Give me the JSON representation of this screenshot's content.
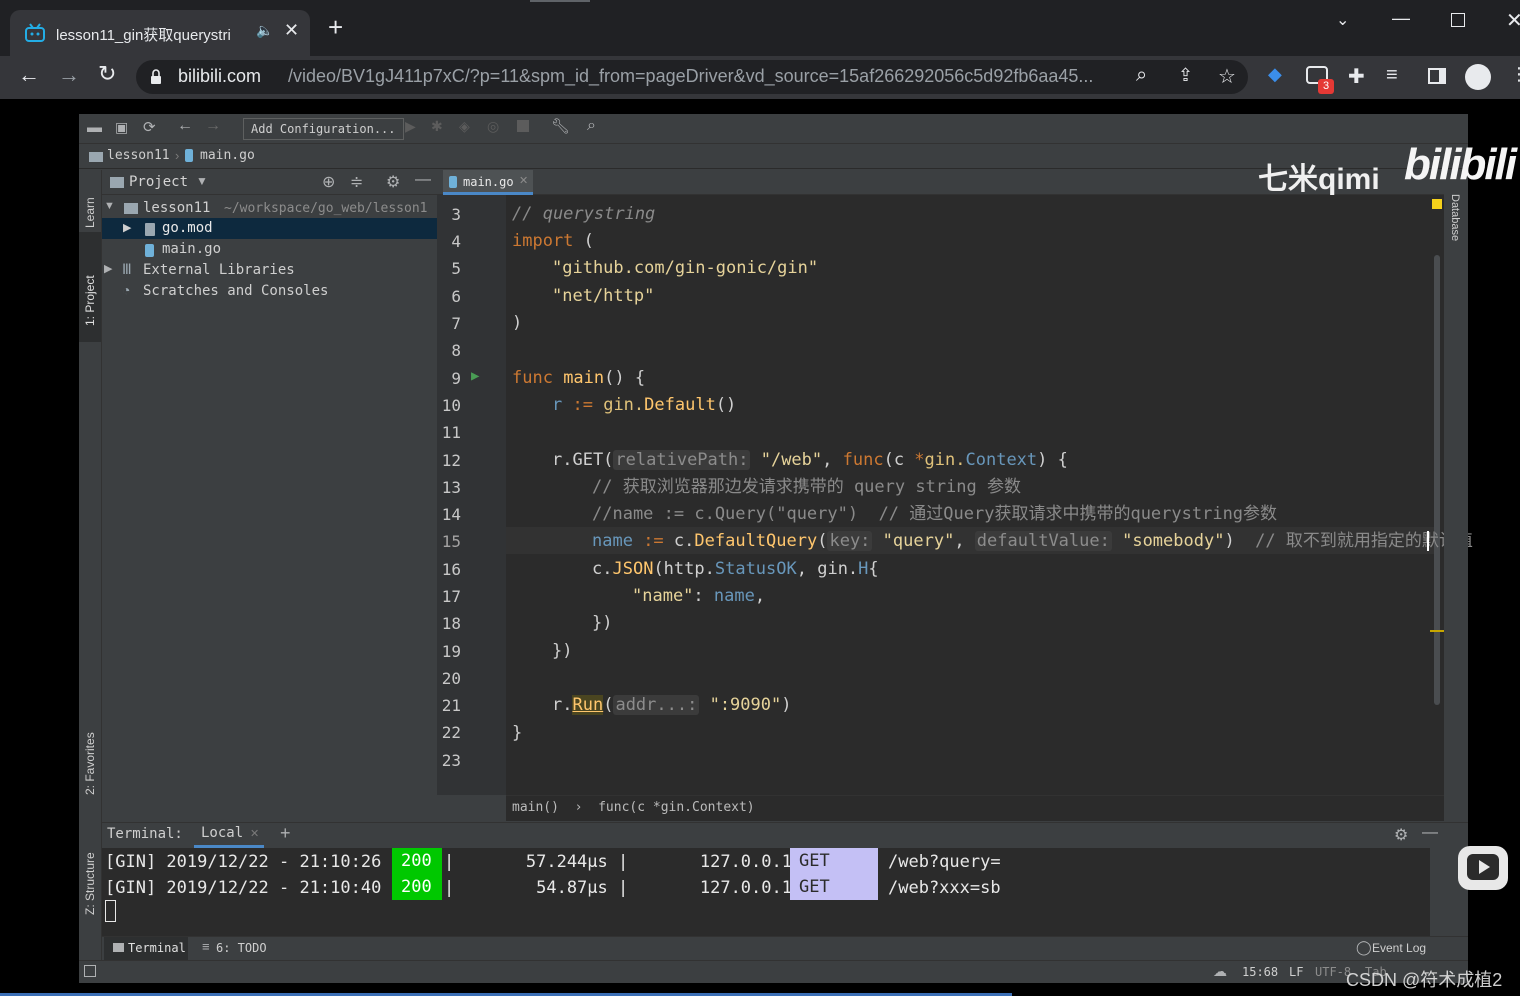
{
  "browser": {
    "tab_title": "lesson11_gin获取querystri",
    "url_host": "bilibili.com",
    "url_path": "/video/BV1gJ411p7xC/?p=11&spm_id_from=pageDriver&vd_source=15af266292056c5d92fb6aa45...",
    "ext_badge": "3"
  },
  "ide": {
    "toolbar": {
      "add_config": "Add Configuration..."
    },
    "breadcrumb": {
      "project": "lesson11",
      "file": "main.go"
    },
    "project_panel": {
      "title": "Project",
      "root": "lesson11",
      "root_path": "~/workspace/go_web/lesson1",
      "items": [
        "go.mod",
        "main.go",
        "External Libraries",
        "Scratches and Consoles"
      ]
    },
    "side_tabs": {
      "learn": "Learn",
      "project": "1: Project",
      "favorites": "2: Favorites",
      "structure": "Z: Structure",
      "database": "Database"
    },
    "editor_tab": "main.go",
    "line_numbers": [
      "3",
      "4",
      "5",
      "6",
      "7",
      "8",
      "9",
      "10",
      "11",
      "12",
      "13",
      "14",
      "15",
      "16",
      "17",
      "18",
      "19",
      "20",
      "21",
      "22",
      "23"
    ],
    "code": {
      "l3": "// querystring",
      "l4a": "import",
      "l4b": " (",
      "l5": "\"github.com/gin-gonic/gin\"",
      "l6": "\"net/http\"",
      "l7": ")",
      "l9a": "func",
      "l9b": " main",
      "l9c": "() {",
      "l10a": "r",
      "l10b": " := ",
      "l10c": "gin.",
      "l10d": "Default",
      "l10e": "()",
      "l12a": "r.GET(",
      "l12b": "relativePath:",
      "l12c": " \"/web\"",
      "l12d": ", ",
      "l12e": "func",
      "l12f": "(c ",
      "l12g": "*",
      "l12h": "gin.",
      "l12i": "Context",
      "l12j": ") {",
      "l13": "// 获取浏览器那边发请求携带的 query string 参数",
      "l14": "//name := c.Query(\"query\")  // 通过Query获取请求中携带的querystring参数",
      "l15a": "name",
      "l15b": " := ",
      "l15c": "c.",
      "l15d": "DefaultQuery",
      "l15e": "(",
      "l15f": "key:",
      "l15g": " \"query\"",
      "l15h": ", ",
      "l15i": "defaultValue:",
      "l15j": " \"somebody\"",
      "l15k": ")",
      "l15l": "  // 取不到就用指定的默认值",
      "l16a": "c.",
      "l16b": "JSON",
      "l16c": "(http.",
      "l16d": "StatusOK",
      "l16e": ", gin.",
      "l16f": "H",
      "l16g": "{",
      "l17a": "\"name\"",
      "l17b": ": ",
      "l17c": "name",
      "l17d": ",",
      "l18": "})",
      "l19": "})",
      "l21a": "r.",
      "l21b": "Run",
      "l21c": "(",
      "l21d": "addr...:",
      "l21e": " \":9090\"",
      "l21f": ")",
      "l22": "}"
    },
    "editor_breadcrumb": "main()  ›  func(c *gin.Context)",
    "terminal": {
      "label": "Terminal:",
      "tab": "Local",
      "rows": [
        {
          "pre": "[GIN] 2019/12/22 - 21:10:26 |",
          "status": "200",
          "mid": "|       57.244µs |       127.0.0.1 |",
          "method": "GET",
          "path": "/web?query="
        },
        {
          "pre": "[GIN] 2019/12/22 - 21:10:40 |",
          "status": "200",
          "mid": "|        54.87µs |       127.0.0.1 |",
          "method": "GET",
          "path": "/web?xxx=sb"
        }
      ]
    },
    "bottom_tabs": {
      "terminal": "Terminal",
      "todo": "6: TODO",
      "event_log": "Event Log"
    },
    "status": {
      "pos": "15:68",
      "sep": "LF",
      "enc": "UTF-8",
      "tab": "Tab"
    }
  },
  "watermark": {
    "qimi": "七米qimi",
    "bili": "bilibili",
    "csdn": "CSDN @符术成植2"
  }
}
